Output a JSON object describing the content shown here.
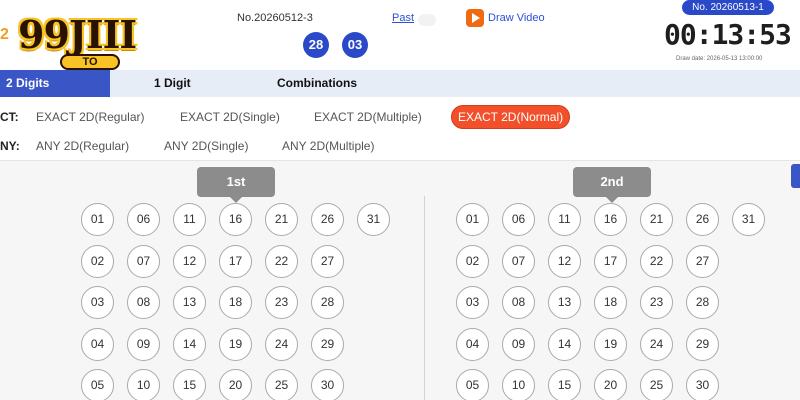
{
  "header": {
    "logo_prefix": "2",
    "logo_text": "99JIII",
    "logo_sub": "TO",
    "prev_draw_no": "No.20260512-3",
    "past_label": "Past",
    "results": [
      "28",
      "03"
    ],
    "draw_video_label": "Draw Video",
    "next_draw_no": "No. 20260513-1",
    "countdown": "00:13:53",
    "draw_date": "Draw date: 2026-05-13 13:00:00"
  },
  "tabs": [
    {
      "label": "2 Digits",
      "active": true
    },
    {
      "label": "1 Digit",
      "active": false
    },
    {
      "label": "Combinations",
      "active": false
    }
  ],
  "exact_row": {
    "label": "CT:",
    "options": [
      {
        "label": "EXACT 2D(Regular)",
        "active": false
      },
      {
        "label": "EXACT 2D(Single)",
        "active": false
      },
      {
        "label": "EXACT 2D(Multiple)",
        "active": false
      },
      {
        "label": "EXACT 2D(Normal)",
        "active": true
      }
    ]
  },
  "any_row": {
    "label": "NY:",
    "options": [
      {
        "label": "ANY 2D(Regular)",
        "active": false
      },
      {
        "label": "ANY 2D(Single)",
        "active": false
      },
      {
        "label": "ANY 2D(Multiple)",
        "active": false
      }
    ]
  },
  "sections": [
    {
      "label": "1st",
      "numbers": [
        [
          "01",
          "06",
          "11",
          "16",
          "21",
          "26",
          "31"
        ],
        [
          "02",
          "07",
          "12",
          "17",
          "22",
          "27"
        ],
        [
          "03",
          "08",
          "13",
          "18",
          "23",
          "28"
        ],
        [
          "04",
          "09",
          "14",
          "19",
          "24",
          "29"
        ],
        [
          "05",
          "10",
          "15",
          "20",
          "25",
          "30"
        ]
      ]
    },
    {
      "label": "2nd",
      "numbers": [
        [
          "01",
          "06",
          "11",
          "16",
          "21",
          "26",
          "31"
        ],
        [
          "02",
          "07",
          "12",
          "17",
          "22",
          "27"
        ],
        [
          "03",
          "08",
          "13",
          "18",
          "23",
          "28"
        ],
        [
          "04",
          "09",
          "14",
          "19",
          "24",
          "29"
        ],
        [
          "05",
          "10",
          "15",
          "20",
          "25",
          "30"
        ]
      ]
    }
  ],
  "colors": {
    "accent_blue": "#3a55c6",
    "ball_blue": "#2a49c8",
    "active_orange": "#f2502a"
  }
}
